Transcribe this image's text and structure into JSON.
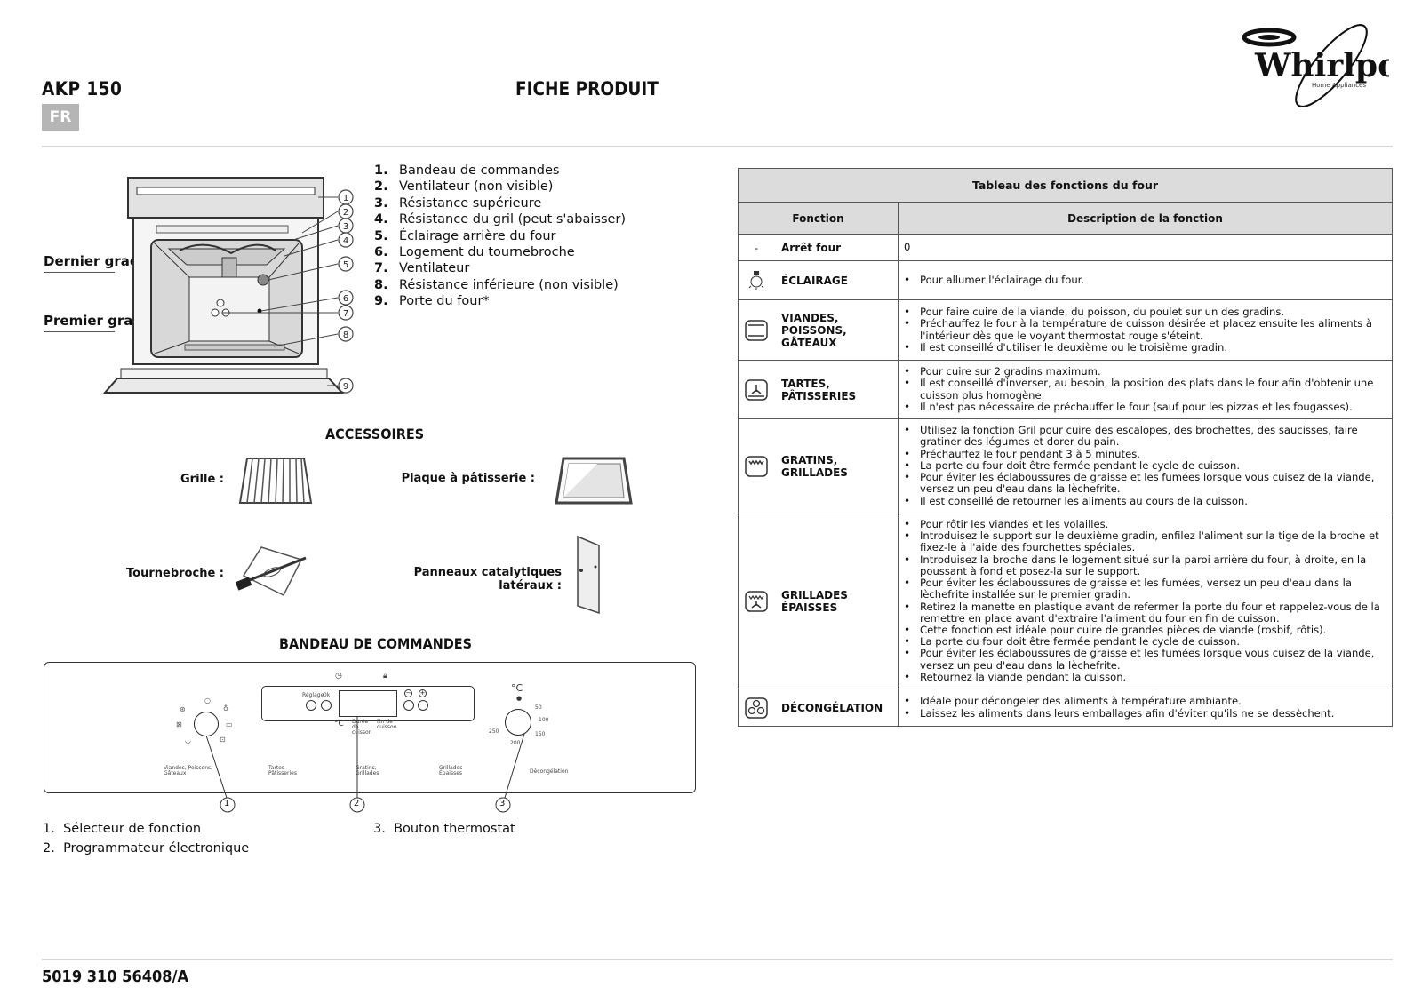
{
  "header": {
    "model": "AKP 150",
    "language_badge": "FR",
    "title": "FICHE PRODUIT",
    "brand": "Whirlpool",
    "brand_tagline": "Home Appliances"
  },
  "oven_diagram": {
    "side_labels": [
      "Dernier gradin",
      "Premier gradin"
    ],
    "callouts": [
      "1",
      "2",
      "3",
      "4",
      "5",
      "6",
      "7",
      "8",
      "9"
    ],
    "parts": [
      {
        "num": "1.",
        "label": "Bandeau de commandes"
      },
      {
        "num": "2.",
        "label": "Ventilateur (non visible)"
      },
      {
        "num": "3.",
        "label": "Résistance supérieure"
      },
      {
        "num": "4.",
        "label": "Résistance du gril (peut s'abaisser)"
      },
      {
        "num": "5.",
        "label": "Éclairage arrière du four"
      },
      {
        "num": "6.",
        "label": "Logement du tournebroche"
      },
      {
        "num": "7.",
        "label": "Ventilateur"
      },
      {
        "num": "8.",
        "label": "Résistance inférieure (non visible)"
      },
      {
        "num": "9.",
        "label": "Porte du four*"
      }
    ]
  },
  "accessories": {
    "heading": "ACCESSOIRES",
    "items": [
      {
        "label": "Grille :",
        "icon": "rack-icon"
      },
      {
        "label": "Plaque à pâtisserie :",
        "icon": "baking-tray-icon"
      },
      {
        "label": "Tournebroche :",
        "icon": "rotisserie-icon"
      },
      {
        "label": "Panneaux catalytiques latéraux :",
        "icon": "catalytic-panel-icon"
      }
    ]
  },
  "control_panel": {
    "heading": "BANDEAU DE COMMANDES",
    "buttons": {
      "reglage": "Réglage",
      "ok": "Ok",
      "minus": "−",
      "plus": "+"
    },
    "display_labels": {
      "celsius": "°C",
      "duree": "Durée de cuisson",
      "fin": "Fin de cuisson"
    },
    "thermostat": {
      "unit": "°C",
      "scale": [
        "50",
        "100",
        "150",
        "200",
        "250"
      ]
    },
    "mode_labels": [
      "Viandes, Poissons, Gâteaux",
      "Tartes Pâtisseries",
      "Gratins, Grillades",
      "Grillades Épaisses",
      "Décongélation"
    ],
    "callouts": [
      "1",
      "2",
      "3"
    ],
    "legend": [
      {
        "num": "1.",
        "label": "Sélecteur de fonction"
      },
      {
        "num": "2.",
        "label": "Programmateur électronique"
      },
      {
        "num": "3.",
        "label": "Bouton thermostat"
      }
    ]
  },
  "function_table": {
    "title": "Tableau des fonctions du four",
    "col_function": "Fonction",
    "col_description": "Description de la fonction",
    "rows": [
      {
        "icon": "dash",
        "name": "Arrêt four",
        "plain": "0",
        "bullets": []
      },
      {
        "icon": "lamp-icon",
        "name": "ÉCLAIRAGE",
        "bullets": [
          "Pour allumer l'éclairage du four."
        ]
      },
      {
        "icon": "top-bottom-heat-icon",
        "name": "VIANDES, POISSONS, GÂTEAUX",
        "bullets": [
          "Pour faire cuire de la viande, du poisson, du poulet sur un des gradins.",
          "Préchauffez le four à la température de cuisson désirée et placez ensuite les aliments à l'intérieur dès que le voyant thermostat rouge s'éteint.",
          "Il est conseillé d'utiliser le deuxième ou le troisième gradin."
        ]
      },
      {
        "icon": "fan-bottom-heat-icon",
        "name": "TARTES, PÂTISSERIES",
        "bullets": [
          "Pour cuire sur 2 gradins maximum.",
          "Il est conseillé d'inverser, au besoin, la position des plats dans le four afin d'obtenir une cuisson plus homogène.",
          "Il n'est pas nécessaire de préchauffer le four (sauf pour les pizzas et les fougasses)."
        ]
      },
      {
        "icon": "grill-icon",
        "name": "GRATINS, GRILLADES",
        "bullets": [
          "Utilisez la fonction Gril pour cuire des escalopes, des brochettes, des saucisses, faire gratiner des légumes et dorer du pain.",
          "Préchauffez le four pendant 3 à 5 minutes.",
          "La porte du four doit être fermée pendant le cycle de cuisson.",
          "Pour éviter les éclaboussures de graisse et les fumées lorsque vous cuisez de la viande, versez un peu d'eau dans la lèchefrite.",
          "Il est conseillé de retourner les aliments au cours de la cuisson."
        ]
      },
      {
        "icon": "fan-grill-icon",
        "name": "GRILLADES ÉPAISSES",
        "bullets": [
          "Pour rôtir les viandes et les volailles.",
          "Introduisez le support sur le deuxième gradin, enfilez l'aliment sur la tige de la broche et fixez-le à l'aide des fourchettes spéciales.",
          "Introduisez la broche dans le logement situé sur la paroi arrière du four, à droite, en la poussant à fond et posez-la sur le support.",
          "Pour éviter les éclaboussures de graisse et les fumées, versez un peu d'eau dans la lèchefrite installée sur le premier gradin.",
          "Retirez la manette en plastique avant de refermer la porte du four et rappelez-vous de la remettre en place avant d'extraire l'aliment du four en fin de cuisson.",
          "Cette fonction est idéale pour cuire de grandes pièces de viande (rosbif, rôtis).",
          "La porte du four doit être fermée pendant le cycle de cuisson.",
          "Pour éviter les éclaboussures de graisse et les fumées lorsque vous cuisez de la viande, versez un peu d'eau dans la lèchefrite.",
          "Retournez la viande pendant la cuisson."
        ]
      },
      {
        "icon": "defrost-fan-icon",
        "name": "DÉCONGÉLATION",
        "bullets": [
          "Idéale pour décongeler des aliments à température ambiante.",
          "Laissez les aliments dans leurs emballages afin d'éviter qu'ils ne se dessèchent."
        ]
      }
    ]
  },
  "footer": {
    "document_code": "5019 310 56408/A"
  }
}
